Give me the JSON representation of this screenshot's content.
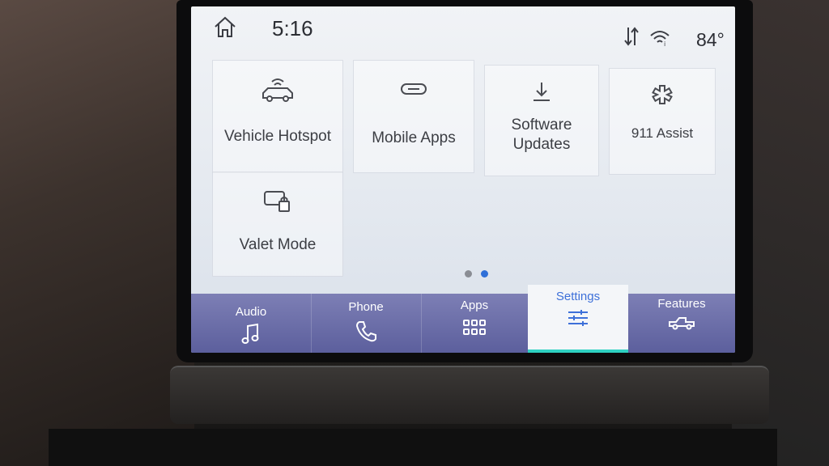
{
  "status": {
    "time": "5:16",
    "temperature": "84°",
    "icons": [
      "home-icon",
      "sort-icon",
      "wifi-icon"
    ]
  },
  "tiles": [
    {
      "label": "Vehicle Hotspot",
      "icon": "car-wifi-icon"
    },
    {
      "label": "Mobile Apps",
      "icon": "link-icon"
    },
    {
      "label_line1": "Software",
      "label_line2": "Updates",
      "icon": "download-icon"
    },
    {
      "label": "911 Assist",
      "icon": "medical-star-icon"
    },
    {
      "label": "Valet Mode",
      "icon": "lock-icon"
    }
  ],
  "pagination": {
    "pages": 2,
    "active": 2
  },
  "nav": {
    "audio": "Audio",
    "phone": "Phone",
    "apps": "Apps",
    "settings": "Settings",
    "features": "Features",
    "active": "Settings"
  },
  "colors": {
    "nav_bar": "#6b6eaa",
    "active_tab_text": "#3d70d9",
    "active_underline": "#2fd1c2",
    "active_dot": "#2f6fd8",
    "inactive_dot": "#8a8d94"
  }
}
